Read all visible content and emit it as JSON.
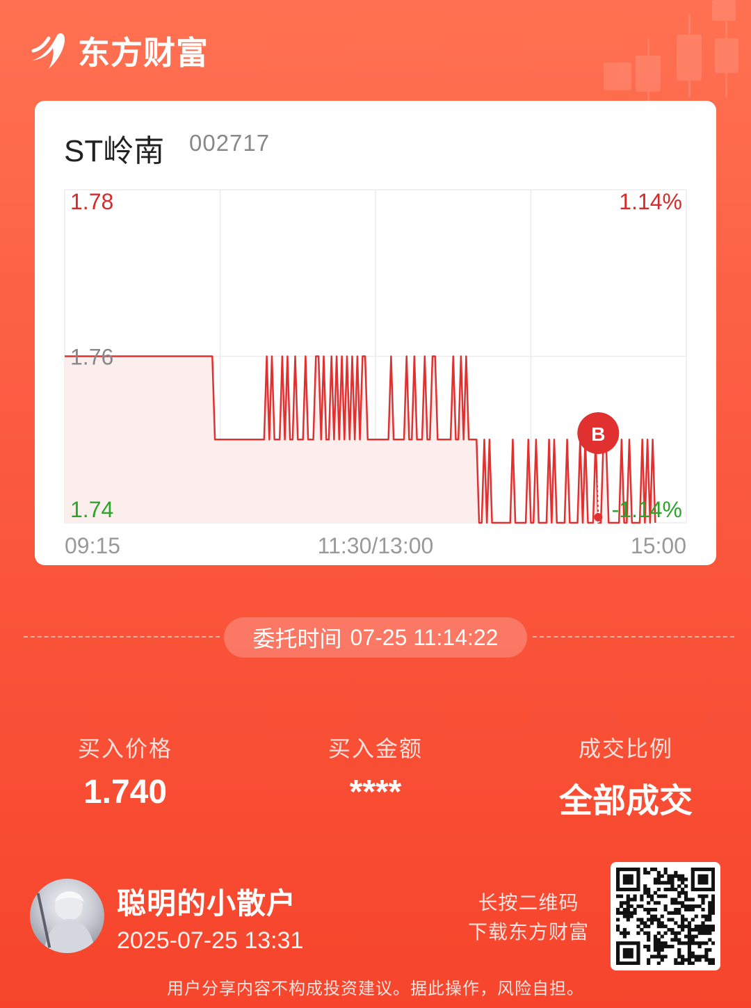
{
  "brand": {
    "name": "东方财富"
  },
  "stock": {
    "name": "ST岭南",
    "code": "002717"
  },
  "chart_data": {
    "type": "line",
    "x_ticks": [
      "09:15",
      "11:30/13:00",
      "15:00"
    ],
    "y_left_labels": [
      "1.78",
      "1.76",
      "1.74"
    ],
    "y_right_labels": [
      "1.14%",
      "-1.14%"
    ],
    "ylim": [
      1.74,
      1.78
    ],
    "prev_close": 1.76,
    "series_values": [
      1.76,
      1.76,
      1.76,
      1.76,
      1.76,
      1.76,
      1.76,
      1.76,
      1.76,
      1.76,
      1.76,
      1.76,
      1.76,
      1.76,
      1.76,
      1.76,
      1.76,
      1.76,
      1.76,
      1.76,
      1.76,
      1.76,
      1.76,
      1.76,
      1.76,
      1.76,
      1.76,
      1.76,
      1.76,
      1.76,
      1.76,
      1.76,
      1.76,
      1.76,
      1.76,
      1.76,
      1.76,
      1.76,
      1.76,
      1.76,
      1.76,
      1.76,
      1.76,
      1.76,
      1.76,
      1.76,
      1.76,
      1.76,
      1.76,
      1.76,
      1.76,
      1.76,
      1.76,
      1.76,
      1.76,
      1.76,
      1.76,
      1.76,
      1.75,
      1.75,
      1.75,
      1.75,
      1.75,
      1.75,
      1.75,
      1.75,
      1.75,
      1.75,
      1.75,
      1.75,
      1.75,
      1.75,
      1.75,
      1.75,
      1.75,
      1.75,
      1.75,
      1.75,
      1.76,
      1.75,
      1.76,
      1.75,
      1.75,
      1.75,
      1.76,
      1.75,
      1.76,
      1.75,
      1.75,
      1.76,
      1.75,
      1.75,
      1.75,
      1.76,
      1.75,
      1.75,
      1.75,
      1.76,
      1.76,
      1.75,
      1.76,
      1.75,
      1.75,
      1.76,
      1.75,
      1.76,
      1.75,
      1.76,
      1.75,
      1.76,
      1.75,
      1.76,
      1.75,
      1.76,
      1.75,
      1.76,
      1.76,
      1.75,
      1.75,
      1.75,
      1.75,
      1.75,
      1.75,
      1.75,
      1.75,
      1.75,
      1.76,
      1.75,
      1.75,
      1.75,
      1.75,
      1.75,
      1.76,
      1.75,
      1.75,
      1.76,
      1.75,
      1.75,
      1.75,
      1.76,
      1.75,
      1.75,
      1.76,
      1.76,
      1.75,
      1.75,
      1.75,
      1.75,
      1.75,
      1.75,
      1.76,
      1.75,
      1.75,
      1.76,
      1.75,
      1.76,
      1.75,
      1.75,
      1.75,
      1.75,
      1.74,
      1.74,
      1.75,
      1.74,
      1.75,
      1.74,
      1.74,
      1.74,
      1.74,
      1.74,
      1.74,
      1.74,
      1.74,
      1.75,
      1.74,
      1.74,
      1.74,
      1.74,
      1.74,
      1.75,
      1.74,
      1.74,
      1.75,
      1.74,
      1.74,
      1.74,
      1.74,
      1.75,
      1.74,
      1.75,
      1.74,
      1.74,
      1.74,
      1.74,
      1.75,
      1.74,
      1.74,
      1.74,
      1.74,
      1.75,
      1.74,
      1.75,
      1.74,
      1.74,
      1.74,
      1.75,
      1.74,
      1.74,
      1.75,
      1.75,
      1.74,
      1.74,
      1.74,
      1.74,
      1.74,
      1.75,
      1.74,
      1.74,
      1.75,
      1.74,
      1.74,
      1.74,
      1.74,
      1.75,
      1.74,
      1.75,
      1.74,
      1.75,
      1.74
    ],
    "total_points": 241,
    "buy_marker": {
      "label": "B",
      "point_index": 206,
      "price": 1.74
    },
    "colors": {
      "line": "#e03030",
      "up": "#d52b2b",
      "down": "#2aa52a",
      "grid": "#ececec",
      "axis_text": "#999999",
      "fill": "#fdeeee"
    }
  },
  "order": {
    "time_label": "委托时间",
    "time_value": "07-25 11:14:22"
  },
  "stats": [
    {
      "label": "买入价格",
      "value": "1.740"
    },
    {
      "label": "买入金额",
      "value": "****"
    },
    {
      "label": "成交比例",
      "value": "全部成交"
    }
  ],
  "user": {
    "name": "聪明的小散户",
    "datetime": "2025-07-25 13:31"
  },
  "qr": {
    "hint_line1": "长按二维码",
    "hint_line2": "下载东方财富"
  },
  "disclaimer": "用户分享内容不构成投资建议。据此操作，风险自担。",
  "colors": {
    "accent": "#f6452c",
    "card_bg": "#ffffff"
  }
}
